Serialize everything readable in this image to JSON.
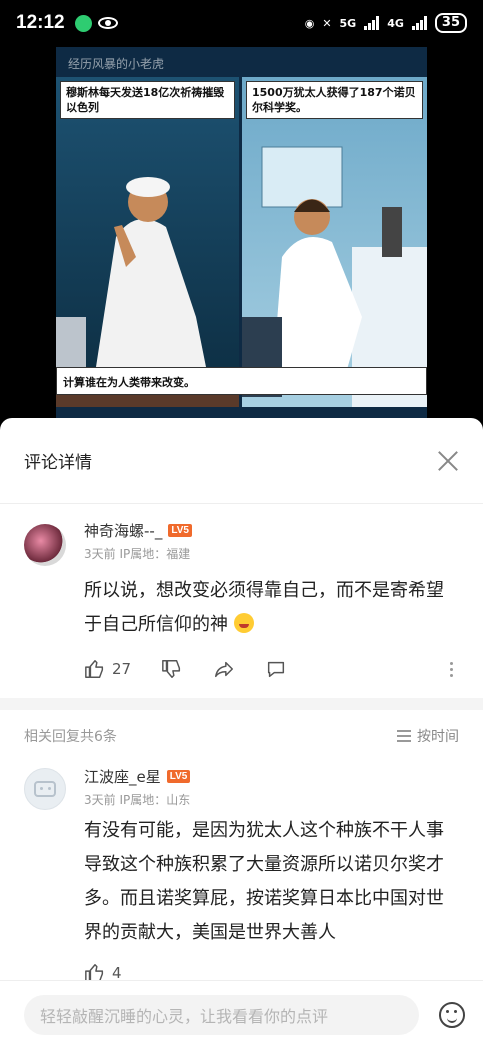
{
  "status_bar": {
    "time": "12:12",
    "network_1": "5G",
    "network_2": "4G",
    "battery": "35"
  },
  "image": {
    "watermark": "经历风暴的小老虎",
    "left_caption": "穆斯林每天发送18亿次祈祷摧毁以色列",
    "right_caption": "1500万犹太人获得了187个诺贝尔科学奖。",
    "bottom_caption": "计算谁在为人类带来改变。"
  },
  "sheet": {
    "title": "评论详情"
  },
  "main_comment": {
    "username": "神奇海螺--_",
    "level": "LV5",
    "time": "3天前",
    "ip_label": "IP属地：福建",
    "text": "所以说，想改变必须得靠自己，而不是寄希望于自己所信仰的神",
    "like_count": "27"
  },
  "replies": {
    "header": "相关回复共6条",
    "sort_label": "按时间"
  },
  "reply_1": {
    "username": "江波座_e星",
    "level": "LV5",
    "time": "3天前",
    "ip_label": "IP属地：山东",
    "text": "有没有可能，是因为犹太人这个种族不干人事导致这个种族积累了大量资源所以诺贝尔奖才多。而且诺奖算屁，按诺奖算日本比中国对世界的贡献大，美国是世界大善人",
    "like_count": "4"
  },
  "input": {
    "placeholder": "轻轻敲醒沉睡的心灵，让我看看你的点评"
  },
  "colors": {
    "level_badge": "#f06a2c",
    "background_dark": "#000000"
  }
}
